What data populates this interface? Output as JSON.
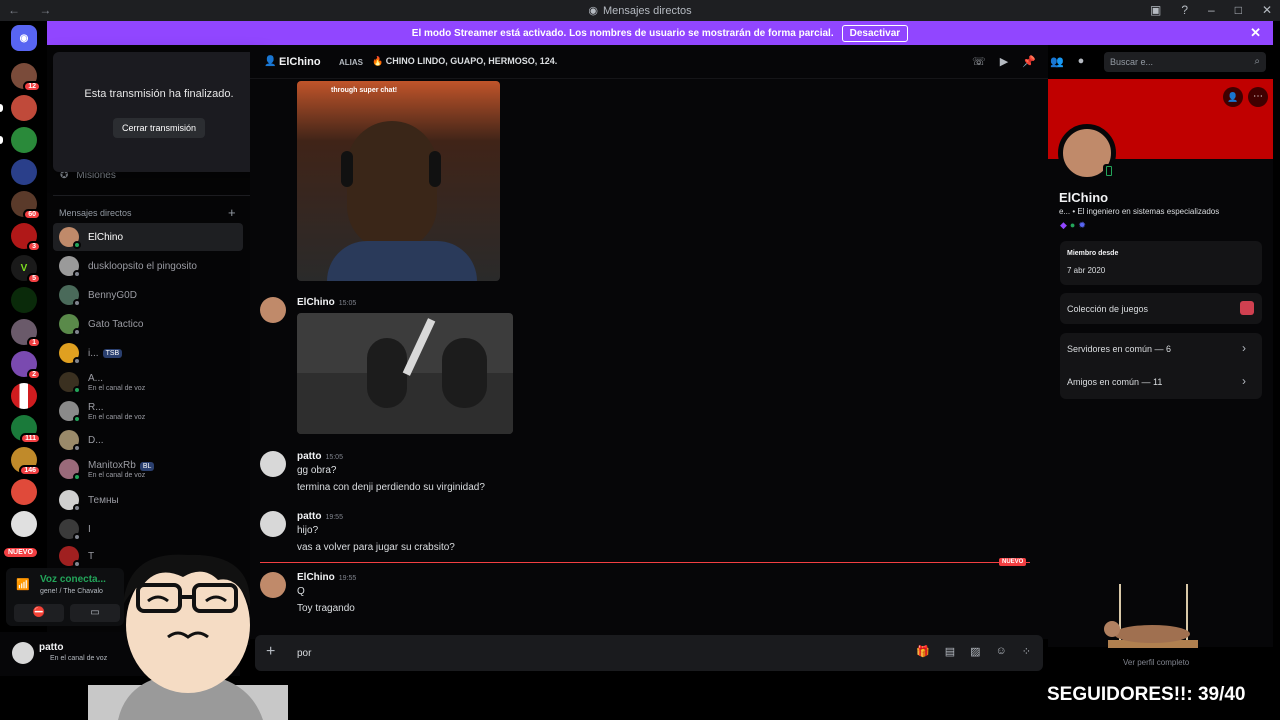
{
  "window": {
    "title": "Mensajes directos"
  },
  "streamer_banner": {
    "text": "El modo Streamer está activado. Los nombres de usuario se mostrarán de forma parcial.",
    "button": "Desactivar",
    "color": "#9146ff"
  },
  "popup": {
    "text": "Esta transmisión ha finalizado.",
    "button": "Cerrar transmisión"
  },
  "sidebar": {
    "missions": "Misiones",
    "dm_header": "Mensajes directos",
    "add": "+",
    "items": [
      {
        "name": "ElChino",
        "sub": ""
      },
      {
        "name": "duskloopsito el pingosito",
        "sub": ""
      },
      {
        "name": "BennyG0D",
        "sub": ""
      },
      {
        "name": "Gato Tactico",
        "sub": ""
      },
      {
        "name": "i...",
        "sub": "",
        "tag": "TSB"
      },
      {
        "name": "A...",
        "sub": "En el canal de voz"
      },
      {
        "name": "R...",
        "sub": "En el canal de voz"
      },
      {
        "name": "D...",
        "sub": ""
      },
      {
        "name": "ManitoxRb",
        "sub": "En el canal de voz",
        "tag": "BL"
      },
      {
        "name": "Темны",
        "sub": ""
      },
      {
        "name": "I",
        "sub": ""
      },
      {
        "name": "T",
        "sub": ""
      }
    ]
  },
  "servers": {
    "badges": [
      "12",
      "",
      "",
      "",
      "60",
      "3",
      "5",
      "",
      "1",
      "2",
      "",
      "111",
      "146",
      "",
      ""
    ],
    "new_label": "NUEVO"
  },
  "voice": {
    "title": "Voz conecta...",
    "channel": "gene! / The Chavalo"
  },
  "user": {
    "name": "patto",
    "status": "En el canal de voz"
  },
  "header": {
    "name": "ElChino",
    "alias_label": "ALIAS",
    "alias_value": "🔥 CHINO LINDO, GUAPO, HERMOSO, 124.",
    "search_placeholder": "Buscar e..."
  },
  "messages": [
    {
      "author": "ElChino",
      "time": "15:05",
      "lines": []
    },
    {
      "author": "patto",
      "time": "15:05",
      "lines": [
        "gg obra?",
        "termina con denji perdiendo su virginidad?"
      ]
    },
    {
      "author": "patto",
      "time": "19:55",
      "lines": [
        "hijo?",
        "vas a volver para jugar su crabsito?"
      ]
    },
    {
      "author": "ElChino",
      "time": "19:55",
      "lines": [
        "Q",
        "Toy tragando"
      ]
    }
  ],
  "image1_caption": "through super chat!",
  "new_divider": "NUEVO",
  "composer": {
    "value": "por"
  },
  "profile": {
    "name": "ElChino",
    "bio": "e... • El ingeniero en sistemas especializados",
    "member_since_label": "Miembro desde",
    "member_since": "7 abr 2020",
    "games": "Colección de juegos",
    "servers_common": "Servidores en común — 6",
    "friends_common": "Amigos en común — 11",
    "view_full": "Ver perfil completo",
    "banner_color": "#c00000"
  },
  "overlay": {
    "followers": "SEGUIDORES!!: 39/40"
  }
}
